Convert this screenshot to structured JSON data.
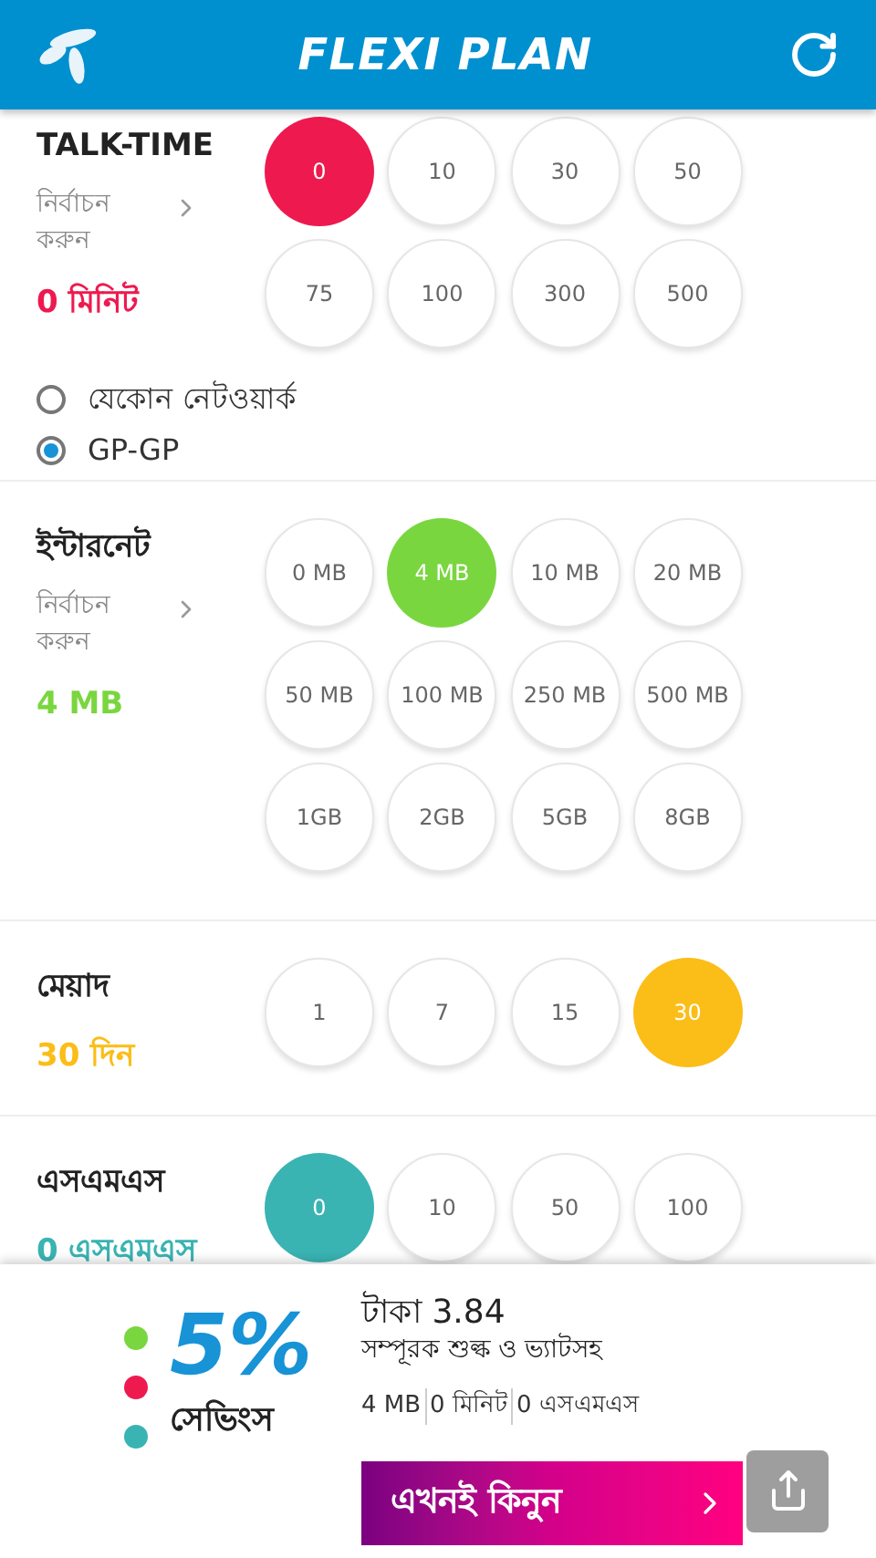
{
  "header": {
    "title": "FLEXI PLAN"
  },
  "sections": [
    {
      "title": "TALK-TIME",
      "select_label": "নির্বাচন করুন",
      "value": "0 মিনিট",
      "color": "#ee1a4f",
      "options": [
        {
          "label": "0",
          "selected": true
        },
        {
          "label": "10",
          "selected": false
        },
        {
          "label": "30",
          "selected": false
        },
        {
          "label": "50",
          "selected": false
        },
        {
          "label": "75",
          "selected": false
        },
        {
          "label": "100",
          "selected": false
        },
        {
          "label": "300",
          "selected": false
        },
        {
          "label": "500",
          "selected": false
        }
      ],
      "networks": [
        {
          "label": "যেকোন নেটওয়ার্ক",
          "selected": false
        },
        {
          "label": "GP-GP",
          "selected": true
        }
      ]
    },
    {
      "title": "ইন্টারনেট",
      "select_label": "নির্বাচন করুন",
      "value": "4 MB",
      "color": "#7ad63f",
      "options": [
        {
          "label": "0 MB",
          "selected": false
        },
        {
          "label": "4 MB",
          "selected": true
        },
        {
          "label": "10 MB",
          "selected": false
        },
        {
          "label": "20 MB",
          "selected": false
        },
        {
          "label": "50 MB",
          "selected": false
        },
        {
          "label": "100 MB",
          "selected": false
        },
        {
          "label": "250 MB",
          "selected": false
        },
        {
          "label": "500 MB",
          "selected": false
        },
        {
          "label": "1GB",
          "selected": false
        },
        {
          "label": "2GB",
          "selected": false
        },
        {
          "label": "5GB",
          "selected": false
        },
        {
          "label": "8GB",
          "selected": false
        }
      ]
    },
    {
      "title": "মেয়াদ",
      "value": "30 দিন",
      "color": "#fbbd17",
      "options": [
        {
          "label": "1",
          "selected": false
        },
        {
          "label": "7",
          "selected": false
        },
        {
          "label": "15",
          "selected": false
        },
        {
          "label": "30",
          "selected": true
        }
      ]
    },
    {
      "title": "এসএমএস",
      "value": "0 এসএমএস",
      "color": "#3ab3b3",
      "options": [
        {
          "label": "0",
          "selected": true
        },
        {
          "label": "10",
          "selected": false
        },
        {
          "label": "50",
          "selected": false
        },
        {
          "label": "100",
          "selected": false
        }
      ]
    }
  ],
  "summary": {
    "dots": [
      {
        "color": "#7ad63f"
      },
      {
        "color": "#ee1a4f"
      },
      {
        "color": "#3ab3b3"
      }
    ],
    "savings_percent": "5%",
    "savings_label": "সেভিংস",
    "price": "টাকা 3.84",
    "price_note": "সম্পূরক শুল্ক ও ভ্যাটসহ",
    "items": [
      "4 MB",
      "0 মিনিট",
      "0 এসএমএস"
    ],
    "buy_label": "এখনই কিনুন"
  }
}
